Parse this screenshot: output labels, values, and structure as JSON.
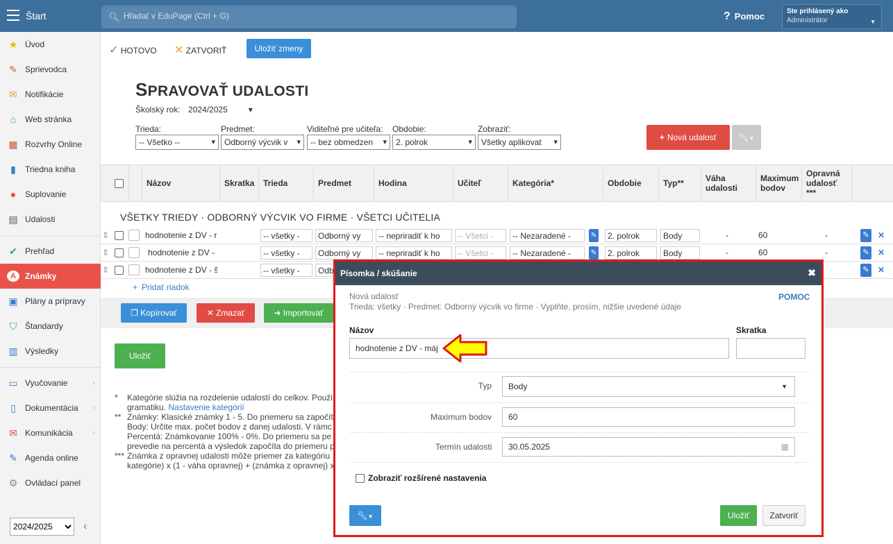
{
  "topbar": {
    "start": "Štart",
    "search_placeholder": "Hľadať v EduPage (Ctrl + G)",
    "help": "Pomoc",
    "user_line1": "Ste prihlásený ako",
    "user_line2": "Administrátor"
  },
  "sidebar": {
    "items": [
      "Úvod",
      "Sprievodca",
      "Notifikácie",
      "Web stránka",
      "Rozvrhy Online",
      "Triedna kniha",
      "Suplovanie",
      "Udalosti",
      "Prehľad",
      "Známky",
      "Plány a prípravy",
      "Štandardy",
      "Výsledky",
      "Vyučovanie",
      "Dokumentácia",
      "Komunikácia",
      "Agenda online",
      "Ovládací panel"
    ],
    "year": "2024/2025"
  },
  "actions": {
    "done": "HOTOVO",
    "close": "ZATVORIŤ",
    "save_changes": "Uložiť zmeny"
  },
  "page": {
    "title_big": "S",
    "title_rest": "PRAVOVAŤ UDALOSTI",
    "school_year_label": "Školský rok:",
    "school_year": "2024/2025"
  },
  "filters": {
    "trieda_label": "Trieda:",
    "trieda": "-- Všetko --",
    "predmet_label": "Predmet:",
    "predmet": "Odborný výcvik v",
    "viditelne_label": "Viditeľné pre učiteľa:",
    "viditelne": "-- bez obmedzen",
    "obdobie_label": "Obdobie:",
    "obdobie": "2. polrok",
    "zobrazit_label": "Zobraziť:",
    "zobrazit": "Všetky aplikovat",
    "new_event": "Nová udalosť"
  },
  "table": {
    "headers": [
      "Názov",
      "Skratka",
      "Trieda",
      "Predmet",
      "Hodina",
      "Učiteľ",
      "Kategória*",
      "Obdobie",
      "Typ**",
      "Váha udalosti",
      "Maximum bodov",
      "Opravná udalosť ***"
    ],
    "group_title": "VŠETKY TRIEDY · ODBORNÝ VÝCVIK VO FIRME · VŠETCI UČITELIA",
    "rows": [
      {
        "name": "hodnotenie z DV - r",
        "trieda": "-- všetky -",
        "predmet": "Odborný vy",
        "hodina": "-- nepriradiť k ho",
        "ucitel": "-- Všetci -",
        "kategoria": "-- Nezaradené -",
        "obdobie": "2. polrok",
        "typ": "Body",
        "vaha": "-",
        "max": "60",
        "opravna": "-"
      },
      {
        "name": "hodnotenie z DV -",
        "trieda": "-- všetky -",
        "predmet": "Odborný vy",
        "hodina": "-- nepriradiť k ho",
        "ucitel": "-- Všetci -",
        "kategoria": "-- Nezaradené -",
        "obdobie": "2. polrok",
        "typ": "Body",
        "vaha": "-",
        "max": "60",
        "opravna": "-"
      },
      {
        "name": "hodnotenie z DV - š",
        "trieda": "-- všetky -",
        "predmet": "Odb"
      }
    ],
    "add_row": "Pridať riadok"
  },
  "bottom": {
    "copy": "Kopírovať",
    "delete": "Zmazať",
    "import": "Importovať",
    "save": "Uložiť"
  },
  "notes": {
    "n1_mark": "*",
    "n1": "Kategórie slúžia na rozdelenie udalostí do celkov. Použi",
    "n1b": "gramatiku.",
    "n1_link": "Nastavenie kategórií",
    "n2_mark": "**",
    "n2a": "Známky: Klasické známky 1 - 5. Do priemeru sa započít",
    "n2b": "Body: Určite max. počet bodov z danej udalosti. V rámc",
    "n2c": "Percentá: Známkovanie 100% - 0%. Do priemeru sa pe",
    "n2d": "prevedie na percentá a výsledok započíta do priemeru p",
    "n3_mark": "***",
    "n3a": "Známka z opravnej udalosti môže priemer za kategóriu",
    "n3b": "kategórie) x (1 - váha opravnej) + (známka z opravnej) x"
  },
  "modal": {
    "title": "Písomka / skúšanie",
    "subtitle": "Nová udalosť",
    "context": "Trieda: všetky · Predmet: Odborný výcvik vo firme · Vyplňte, prosím, nižšie uvedené údaje",
    "help": "POMOC",
    "name_label": "Názov",
    "name_value": "hodnotenie z DV - máj",
    "abbr_label": "Skratka",
    "abbr_value": "",
    "type_label": "Typ",
    "type_value": "Body",
    "max_label": "Maximum bodov",
    "max_value": "60",
    "date_label": "Termín udalosti",
    "date_value": "30.05.2025",
    "advanced": "Zobraziť rozšírené nastavenia",
    "save": "Uložiť",
    "close": "Zatvoriť"
  },
  "colors": {
    "topbar": "#3d6f9c",
    "active": "#e8524b",
    "accent_blue": "#3a8fd8",
    "modal_border": "#e01919"
  }
}
